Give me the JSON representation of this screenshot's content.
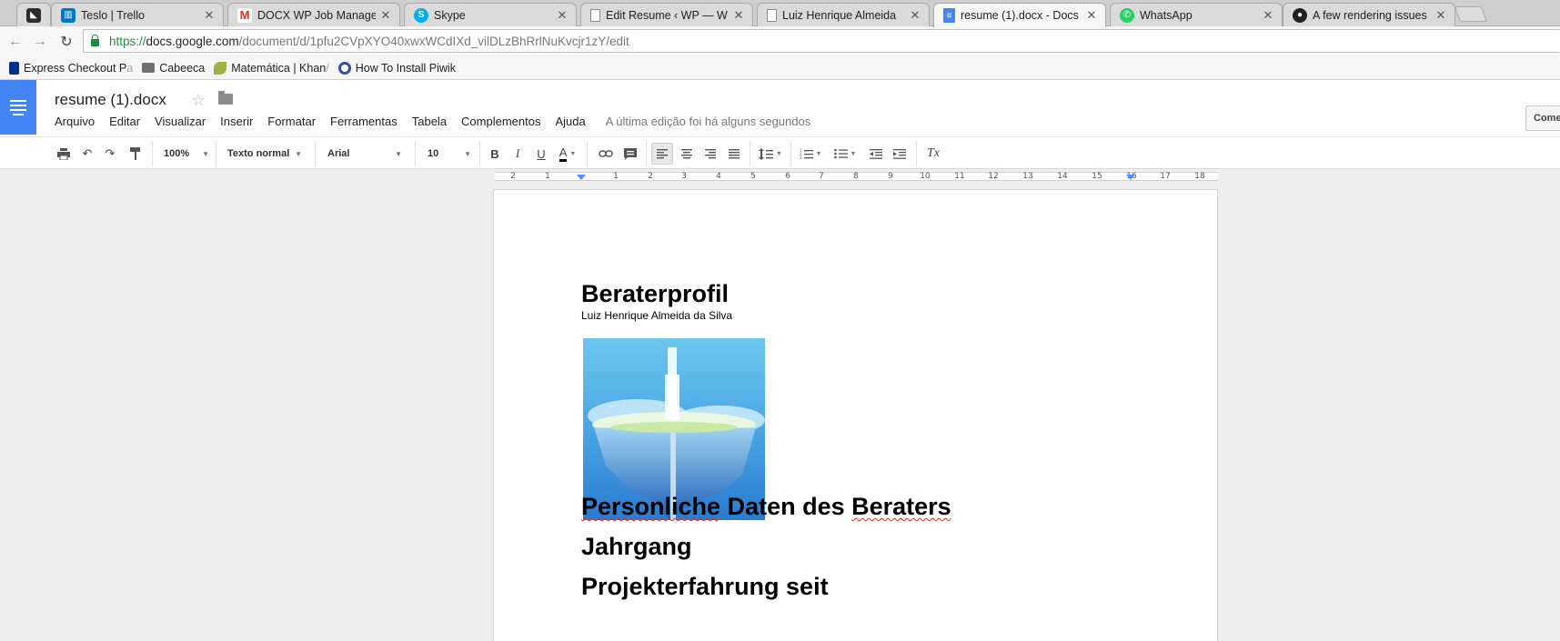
{
  "tabs": [
    {
      "label": "",
      "favicon": "app-favicon",
      "color": "#2d2d2d"
    },
    {
      "label": "Teslo | Trello",
      "favicon": "trello-icon",
      "color": "#0079bf"
    },
    {
      "label": "DOCX WP Job Manager",
      "favicon": "gmail-icon",
      "color": "#d93025"
    },
    {
      "label": "Skype",
      "favicon": "skype-icon",
      "color": "#00aff0"
    },
    {
      "label": "Edit Resume ‹ WP — W",
      "favicon": "page-icon",
      "color": "#888888"
    },
    {
      "label": "Luiz Henrique Almeida",
      "favicon": "page-icon",
      "color": "#888888"
    },
    {
      "label": "resume (1).docx - Docs",
      "favicon": "docs-icon",
      "color": "#4285f4"
    },
    {
      "label": "WhatsApp",
      "favicon": "whatsapp-icon",
      "color": "#25d366"
    },
    {
      "label": "A few rendering issues",
      "favicon": "github-icon",
      "color": "#222222"
    }
  ],
  "url": {
    "scheme": "https://",
    "host": "docs.google.com",
    "path": "/document/d/1pfu2CVpXYO40xwxWCdIXd_vilDLzBhRrlNuKvcjr1zY/edit"
  },
  "bookmarks": [
    {
      "label": "Express Checkout P",
      "fade": "a",
      "icon": "paypal-icon"
    },
    {
      "label": "Cabeeca",
      "fade": "",
      "icon": "folder-icon"
    },
    {
      "label": "Matemática | Khan",
      "fade": " /",
      "icon": "khan-icon"
    },
    {
      "label": "How To Install Piwik",
      "fade": "",
      "icon": "piwik-icon"
    }
  ],
  "doc": {
    "title": "resume (1).docx",
    "menu": [
      "Arquivo",
      "Editar",
      "Visualizar",
      "Inserir",
      "Formatar",
      "Ferramentas",
      "Tabela",
      "Complementos",
      "Ajuda"
    ],
    "last_edit": "A última edição foi há alguns segundos",
    "comment_button": "Come"
  },
  "toolbar": {
    "zoom": "100%",
    "style": "Texto normal",
    "font": "Arial",
    "size": "10",
    "bold": "B",
    "italic": "I",
    "underline": "U",
    "text_color": "A",
    "clear_format": "Tx"
  },
  "ruler": [
    "2",
    "1",
    "",
    "1",
    "2",
    "3",
    "4",
    "5",
    "6",
    "7",
    "8",
    "9",
    "10",
    "11",
    "12",
    "13",
    "14",
    "15",
    "16",
    "17",
    "18"
  ],
  "content": {
    "heading": "Beraterprofil",
    "name": "Luiz Henrique Almeida da Silva",
    "sec1_a": "Personliche",
    "sec1_b": " Daten des ",
    "sec1_c": "Beraters",
    "sec2": "Jahrgang",
    "sec3": "Projekterfahrung seit"
  }
}
